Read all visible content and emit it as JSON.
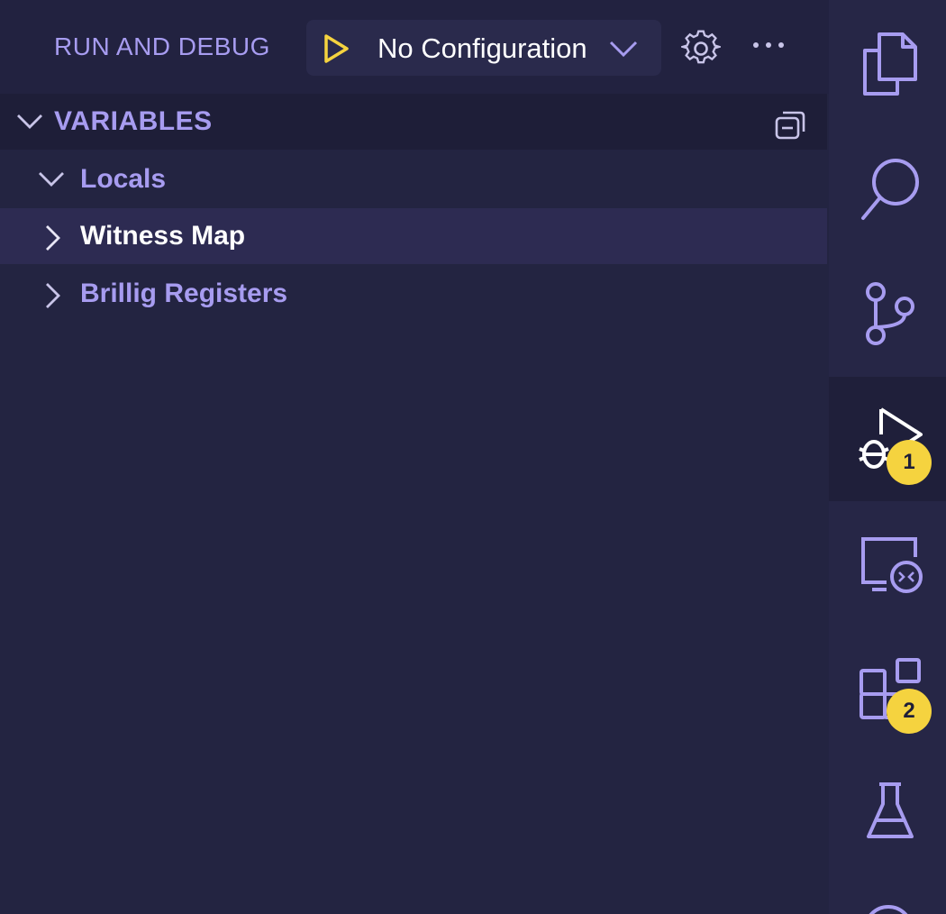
{
  "header": {
    "title": "RUN AND DEBUG",
    "configuration": "No Configuration",
    "play_icon": "play-icon",
    "settings_icon": "gear-icon",
    "more_icon": "ellipsis-icon"
  },
  "variables": {
    "title": "VARIABLES",
    "collapse_icon": "collapse-all-icon",
    "items": [
      {
        "label": "Locals",
        "expanded": true,
        "level": 0
      },
      {
        "label": "Witness Map",
        "expanded": false,
        "level": 1,
        "selected": true
      },
      {
        "label": "Brillig Registers",
        "expanded": false,
        "level": 1
      }
    ]
  },
  "activity_bar": {
    "items": [
      {
        "name": "explorer",
        "icon": "files-icon"
      },
      {
        "name": "search",
        "icon": "search-icon"
      },
      {
        "name": "source-control",
        "icon": "source-control-icon"
      },
      {
        "name": "run-and-debug",
        "icon": "debug-icon",
        "badge": "1",
        "active": true
      },
      {
        "name": "remote-explorer",
        "icon": "remote-explorer-icon"
      },
      {
        "name": "extensions",
        "icon": "extensions-icon",
        "badge": "2"
      },
      {
        "name": "testing",
        "icon": "beaker-icon"
      }
    ]
  },
  "colors": {
    "accent": "#a79cf0",
    "play": "#f5d33f",
    "badge": "#f5d33f",
    "background": "#232441",
    "selected_row": "#2d2b52"
  }
}
